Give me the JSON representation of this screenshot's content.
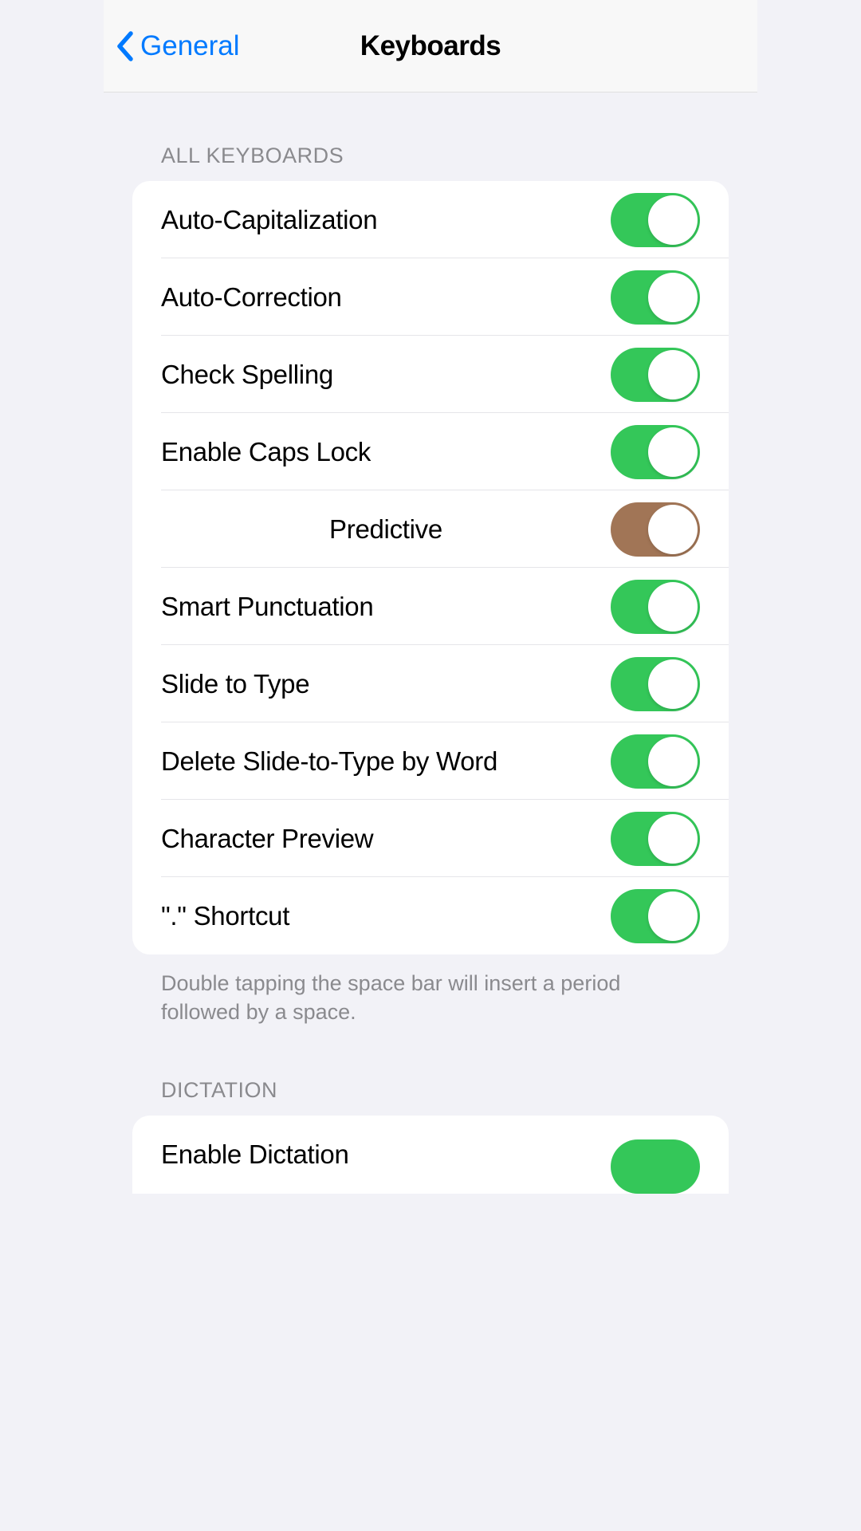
{
  "nav": {
    "back_label": "General",
    "title": "Keyboards"
  },
  "sections": {
    "all_keyboards": {
      "header": "ALL KEYBOARDS",
      "footer": "Double tapping the space bar will insert a period followed by a space.",
      "rows": [
        {
          "label": "Auto-Capitalization",
          "on": true,
          "highlighted": false
        },
        {
          "label": "Auto-Correction",
          "on": true,
          "highlighted": false
        },
        {
          "label": "Check Spelling",
          "on": true,
          "highlighted": false
        },
        {
          "label": "Enable Caps Lock",
          "on": true,
          "highlighted": false
        },
        {
          "label": "Predictive",
          "on": true,
          "highlighted": true
        },
        {
          "label": "Smart Punctuation",
          "on": true,
          "highlighted": false
        },
        {
          "label": "Slide to Type",
          "on": true,
          "highlighted": false
        },
        {
          "label": "Delete Slide-to-Type by Word",
          "on": true,
          "highlighted": false
        },
        {
          "label": "Character Preview",
          "on": true,
          "highlighted": false
        },
        {
          "label": "\".\" Shortcut",
          "on": true,
          "highlighted": false
        }
      ]
    },
    "dictation": {
      "header": "DICTATION",
      "rows": [
        {
          "label": "Enable Dictation",
          "on": true,
          "highlighted": false
        }
      ]
    }
  }
}
